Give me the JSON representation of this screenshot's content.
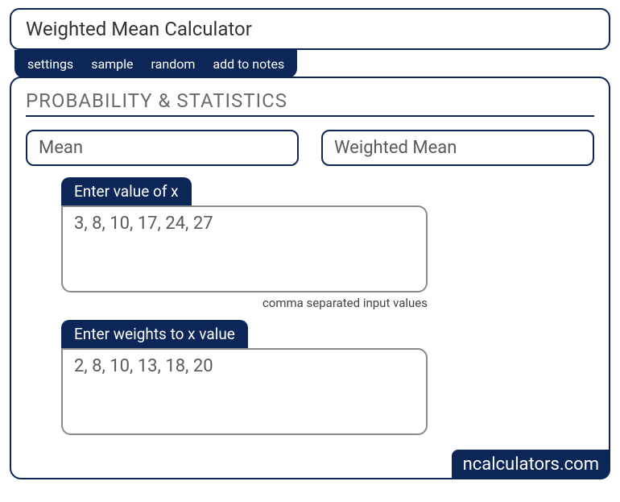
{
  "title": "Weighted Mean Calculator",
  "tabs": {
    "settings": "settings",
    "sample": "sample",
    "random": "random",
    "add_notes": "add to notes"
  },
  "section_title": "PROBABILITY & STATISTICS",
  "modes": {
    "mean": "Mean",
    "weighted_mean": "Weighted Mean"
  },
  "field_x": {
    "label": "Enter value of x",
    "value": "3, 8, 10, 17, 24, 27",
    "hint": "comma separated input values"
  },
  "field_w": {
    "label": "Enter weights to x value",
    "value": "2, 8, 10, 13, 18, 20"
  },
  "brand": "ncalculators.com"
}
